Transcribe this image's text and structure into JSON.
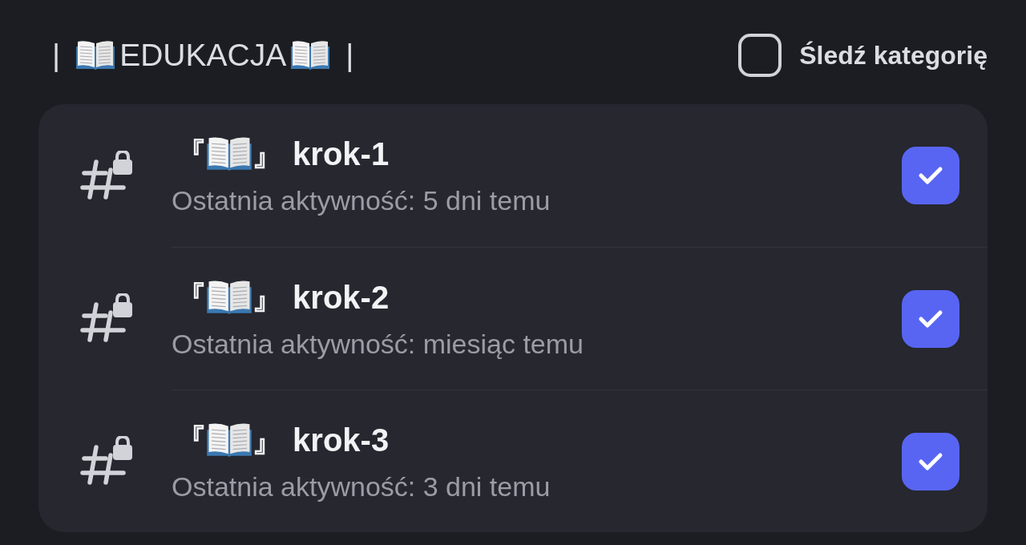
{
  "category": {
    "title_parts": [
      {
        "kind": "bar",
        "text": "|"
      },
      {
        "kind": "book"
      },
      {
        "kind": "text",
        "text": "EDUKACJA"
      },
      {
        "kind": "book"
      },
      {
        "kind": "bar",
        "text": "|"
      }
    ],
    "follow": {
      "label": "Śledź kategorię",
      "checked": false
    }
  },
  "channels": [
    {
      "name_parts": [
        {
          "kind": "text",
          "text": "『"
        },
        {
          "kind": "book"
        },
        {
          "kind": "text",
          "text": "』 krok-1"
        }
      ],
      "locked": true,
      "activity": "Ostatnia aktywność: 5 dni temu",
      "checked": true
    },
    {
      "name_parts": [
        {
          "kind": "text",
          "text": "『"
        },
        {
          "kind": "book"
        },
        {
          "kind": "text",
          "text": "』 krok-2"
        }
      ],
      "locked": true,
      "activity": "Ostatnia aktywność: miesiąc temu",
      "checked": true
    },
    {
      "name_parts": [
        {
          "kind": "text",
          "text": "『"
        },
        {
          "kind": "book"
        },
        {
          "kind": "text",
          "text": "』 krok-3"
        }
      ],
      "locked": true,
      "activity": "Ostatnia aktywność: 3 dni temu",
      "checked": true
    }
  ]
}
